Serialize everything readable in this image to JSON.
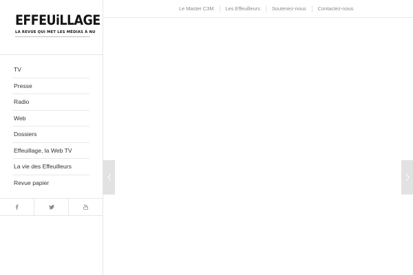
{
  "logo": {
    "title": "EFFEUiLLAGE",
    "tagline": "LA REVUE QUI MET LES MÉDIAS À NU"
  },
  "menu": {
    "items": [
      {
        "label": "TV"
      },
      {
        "label": "Presse"
      },
      {
        "label": "Radio"
      },
      {
        "label": "Web"
      },
      {
        "label": "Dossiers"
      },
      {
        "label": "Effeuillage, la Web TV"
      },
      {
        "label": "La vie des Effeuilleurs"
      },
      {
        "label": "Revue papier"
      }
    ]
  },
  "social": {
    "icons": [
      "facebook-icon",
      "twitter-icon",
      "youtube-icon"
    ],
    "color": "#8a8a8a"
  },
  "topnav": {
    "items": [
      {
        "label": "Le Master C3M"
      },
      {
        "label": "Les Effeuilleurs"
      },
      {
        "label": "Soutenez-nous"
      },
      {
        "label": "Contactez-nous"
      }
    ]
  },
  "slider": {
    "prev_icon": "chevron-left-icon",
    "next_icon": "chevron-right-icon",
    "arrow_bg": "#e2e2e2"
  }
}
